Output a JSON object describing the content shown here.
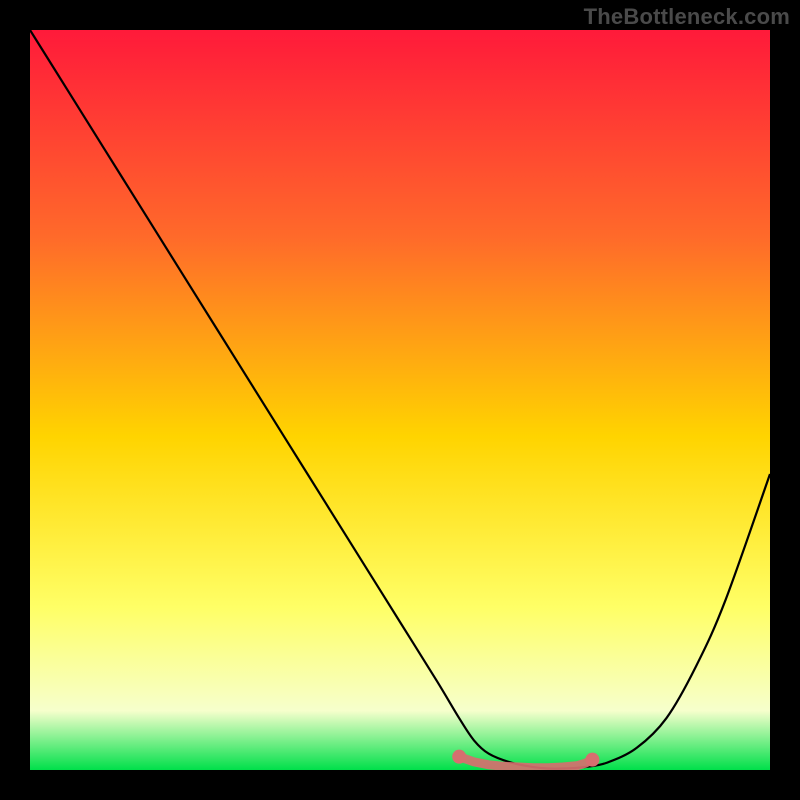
{
  "watermark": "TheBottleneck.com",
  "colors": {
    "background": "#000000",
    "gradient_top": "#ff1a3a",
    "gradient_mid_upper": "#ff6a2a",
    "gradient_mid": "#ffd400",
    "gradient_mid_lower": "#ffff66",
    "gradient_lower": "#f6ffcc",
    "gradient_bottom": "#00e04a",
    "curve_stroke": "#000000",
    "dot_fill": "#d66f6f",
    "dot_fill_light": "#e79a9a"
  },
  "chart_data": {
    "type": "line",
    "title": "",
    "xlabel": "",
    "ylabel": "",
    "xlim": [
      0,
      100
    ],
    "ylim": [
      0,
      100
    ],
    "x": [
      0,
      5,
      10,
      15,
      20,
      25,
      30,
      35,
      40,
      45,
      50,
      55,
      58,
      60,
      62,
      65,
      68,
      70,
      72,
      75,
      78,
      82,
      86,
      90,
      94,
      100
    ],
    "y": [
      100,
      92,
      84,
      76,
      68,
      60,
      52,
      44,
      36,
      28,
      20,
      12,
      7,
      4,
      2.2,
      1.0,
      0.4,
      0.2,
      0.2,
      0.4,
      1.0,
      3,
      7,
      14,
      23,
      40
    ],
    "annotations": {
      "scatter_cluster_x": [
        58,
        60,
        62,
        64,
        66,
        68,
        70,
        72,
        74,
        75,
        76
      ],
      "scatter_cluster_y": [
        1.8,
        1.1,
        0.7,
        0.5,
        0.4,
        0.3,
        0.3,
        0.4,
        0.6,
        0.9,
        1.4
      ]
    }
  }
}
